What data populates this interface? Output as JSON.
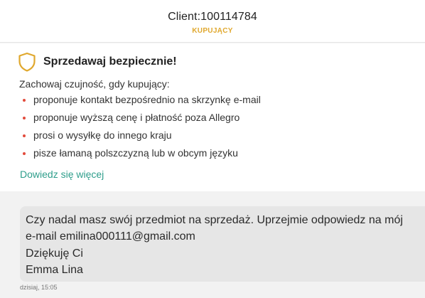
{
  "header": {
    "client": "Client:100114784",
    "role": "KUPUJĄCY"
  },
  "safety": {
    "icon": "shield-icon",
    "title": "Sprzedawaj bezpiecznie!",
    "intro": "Zachowaj czujność, gdy kupujący:",
    "items": [
      "proponuje kontakt bezpośrednio na skrzynkę e-mail",
      "proponuje wyższą cenę i płatność poza Allegro",
      "prosi o wysyłkę do innego kraju",
      "pisze łamaną polszczyzną lub w obcym języku"
    ],
    "learn_more": "Dowiedz się więcej",
    "colors": {
      "shield": "#e0a82e",
      "bullet": "#e24b3c",
      "link": "#2e9e8b"
    }
  },
  "message": {
    "lines": [
      "Czy nadal masz swój przedmiot na sprzedaż. Uprzejmie odpowiedz na mój",
      "e-mail emilina000111@gmail.com",
      "Dziękuję Ci",
      "Emma Lina"
    ],
    "timestamp": "dzisiaj, 15:05"
  }
}
